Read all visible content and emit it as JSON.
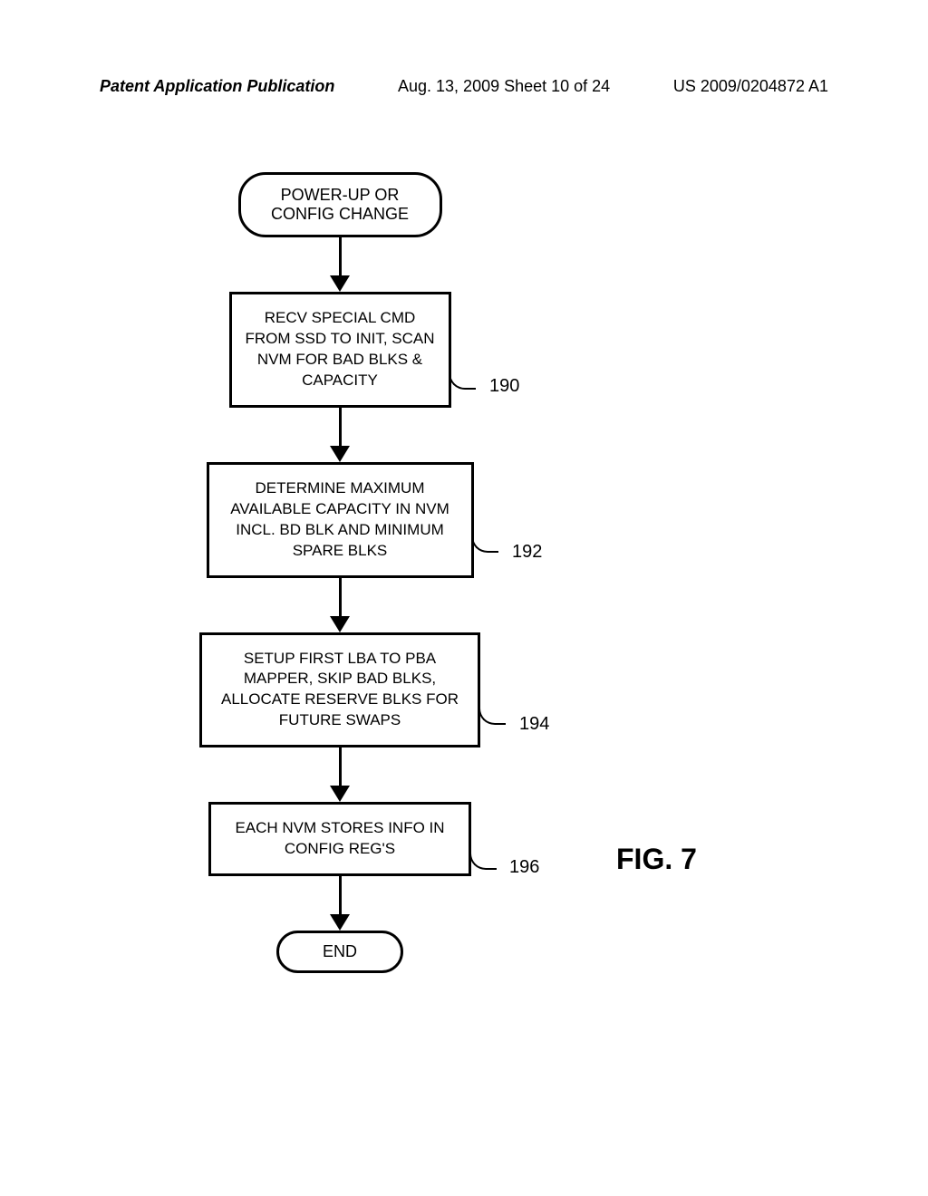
{
  "header": {
    "left": "Patent Application Publication",
    "center": "Aug. 13, 2009  Sheet 10 of 24",
    "right": "US 2009/0204872 A1"
  },
  "flowchart": {
    "start": "POWER-UP OR CONFIG CHANGE",
    "step190": "RECV SPECIAL CMD FROM SSD TO INIT, SCAN NVM FOR BAD BLKS & CAPACITY",
    "ref190": "190",
    "step192": "DETERMINE MAXIMUM AVAILABLE CAPACITY IN NVM INCL. BD BLK AND MINIMUM SPARE BLKS",
    "ref192": "192",
    "step194": "SETUP FIRST LBA TO PBA MAPPER, SKIP BAD BLKS, ALLOCATE RESERVE BLKS FOR FUTURE SWAPS",
    "ref194": "194",
    "step196": "EACH NVM STORES INFO IN CONFIG REG'S",
    "ref196": "196",
    "end": "END"
  },
  "figure_label": "FIG. 7"
}
